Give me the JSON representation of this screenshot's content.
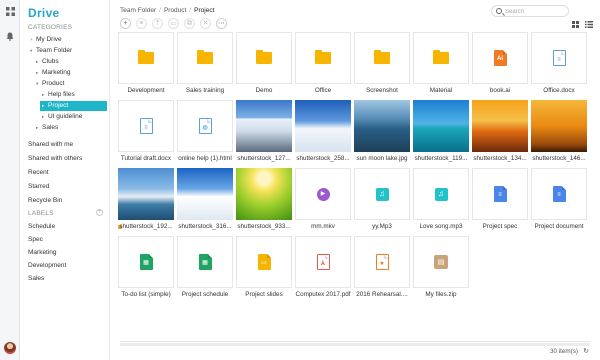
{
  "app": {
    "logo": "Drive"
  },
  "sidebar": {
    "categories_title": "CATEGORIES",
    "tree": [
      {
        "label": "My Drive",
        "level": 0,
        "caret": "+",
        "active": false
      },
      {
        "label": "Team Folder",
        "level": 0,
        "caret": "▾",
        "active": false
      },
      {
        "label": "Clubs",
        "level": 1,
        "caret": "▸",
        "active": false
      },
      {
        "label": "Marketing",
        "level": 1,
        "caret": "▸",
        "active": false
      },
      {
        "label": "Product",
        "level": 1,
        "caret": "▾",
        "active": false
      },
      {
        "label": "Help files",
        "level": 2,
        "caret": "▸",
        "active": false
      },
      {
        "label": "Project",
        "level": 2,
        "caret": "▸",
        "active": true
      },
      {
        "label": "UI guideline",
        "level": 2,
        "caret": "▸",
        "active": false
      },
      {
        "label": "Sales",
        "level": 1,
        "caret": "▸",
        "active": false
      }
    ],
    "items": [
      "Shared with me",
      "Shared with others",
      "Recent",
      "Starred",
      "Recycle Bin"
    ],
    "labels_title": "LABELS",
    "labels": [
      {
        "label": "Schedule",
        "color": "#f5a623"
      },
      {
        "label": "Spec",
        "color": "#f0a35e"
      },
      {
        "label": "Marketing",
        "color": "#e8557a"
      },
      {
        "label": "Development",
        "color": "#4cb85c"
      },
      {
        "label": "Sales",
        "color": "#3d8de0"
      }
    ]
  },
  "breadcrumb": [
    "Team Folder",
    "Product",
    "Project"
  ],
  "search": {
    "placeholder": "Search"
  },
  "toolbar": [
    "add-icon",
    "link-icon",
    "upload-icon",
    "folder-new-icon",
    "copy-icon",
    "delete-icon",
    "more-icon"
  ],
  "files": [
    {
      "name": "Development",
      "kind": "folder"
    },
    {
      "name": "Sales training",
      "kind": "folder"
    },
    {
      "name": "Demo",
      "kind": "folder"
    },
    {
      "name": "Office",
      "kind": "folder"
    },
    {
      "name": "Screenshot",
      "kind": "folder"
    },
    {
      "name": "Material",
      "kind": "folder"
    },
    {
      "name": "book.ai",
      "kind": "ai"
    },
    {
      "name": "Office.docx",
      "kind": "docx"
    },
    {
      "name": "Tutorial draft.docx",
      "kind": "docx"
    },
    {
      "name": "online help (1).html",
      "kind": "html"
    },
    {
      "name": "shutterstock_127...",
      "kind": "photo",
      "photo": "mountain"
    },
    {
      "name": "shutterstock_258...",
      "kind": "photo",
      "photo": "snow"
    },
    {
      "name": "sun moon lake.jpg",
      "kind": "photo",
      "photo": "lake"
    },
    {
      "name": "shutterstock_119...",
      "kind": "photo",
      "photo": "ocean"
    },
    {
      "name": "shutterstock_134...",
      "kind": "photo",
      "photo": "sunset"
    },
    {
      "name": "shutterstock_146...",
      "kind": "photo",
      "photo": "deer"
    },
    {
      "name": "shutterstock_192...",
      "kind": "photo",
      "photo": "city"
    },
    {
      "name": "shutterstock_316...",
      "kind": "photo",
      "photo": "ski"
    },
    {
      "name": "shutterstock_933...",
      "kind": "photo",
      "photo": "field"
    },
    {
      "name": "mm.mkv",
      "kind": "video"
    },
    {
      "name": "yy.Mp3",
      "kind": "audio"
    },
    {
      "name": "Love song.mp3",
      "kind": "audio"
    },
    {
      "name": "Project spec",
      "kind": "gdoc"
    },
    {
      "name": "Project document",
      "kind": "gdoc"
    },
    {
      "name": "To-do list (simple)",
      "kind": "sheet"
    },
    {
      "name": "Project schedule",
      "kind": "sheet"
    },
    {
      "name": "Project slides",
      "kind": "slides"
    },
    {
      "name": "Computex 2017.pdf",
      "kind": "pdf"
    },
    {
      "name": "2016 Rehearsal....",
      "kind": "presentation"
    },
    {
      "name": "My files.zip",
      "kind": "zip"
    }
  ],
  "status": {
    "count": "30 item(s)"
  }
}
